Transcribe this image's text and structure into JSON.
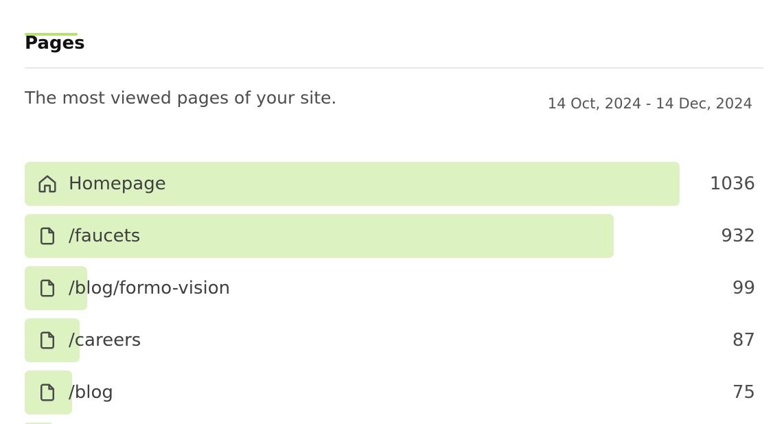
{
  "tab": {
    "label": "Pages",
    "accent_color": "#b6e36a"
  },
  "description": "The most viewed pages of your site.",
  "date_range": "14 Oct, 2024 - 14 Dec, 2024",
  "bar_color": "#dcf2c1",
  "rows": [
    {
      "label": "Homepage",
      "value": "1036",
      "icon": "home-icon"
    },
    {
      "label": "/faucets",
      "value": "932",
      "icon": "file-icon"
    },
    {
      "label": "/blog/formo-vision",
      "value": "99",
      "icon": "file-icon"
    },
    {
      "label": "/careers",
      "value": "87",
      "icon": "file-icon"
    },
    {
      "label": "/blog",
      "value": "75",
      "icon": "file-icon"
    }
  ]
}
